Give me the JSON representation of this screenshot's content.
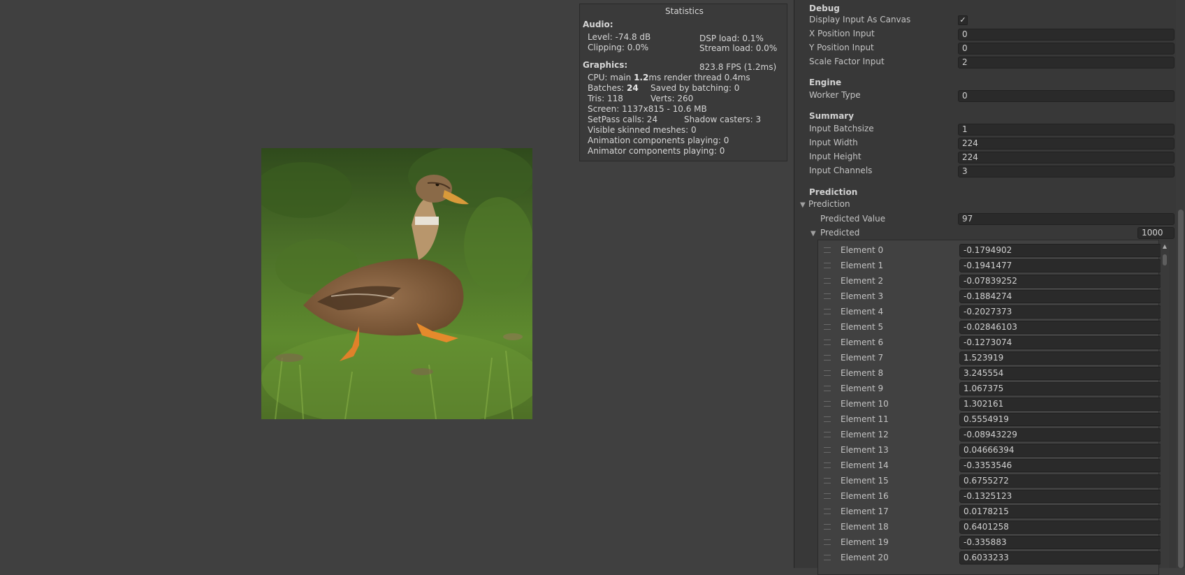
{
  "statistics": {
    "title": "Statistics",
    "audio_header": "Audio:",
    "level": "Level: -74.8 dB",
    "clipping": "Clipping: 0.0%",
    "dsp_load": "DSP load: 0.1%",
    "stream_load": "Stream load: 0.0%",
    "graphics_header": "Graphics:",
    "fps": "823.8 FPS (1.2ms)",
    "cpu_prefix": "CPU: main ",
    "cpu_main": "1.2",
    "cpu_suffix": "ms  render thread 0.4ms",
    "batches_prefix": "Batches: ",
    "batches_value": "24",
    "saved_by_batching": "Saved by batching: 0",
    "tris": "Tris: 118",
    "verts": "Verts: 260",
    "screen": "Screen: 1137x815 - 10.6 MB",
    "setpass_calls": "SetPass calls: 24",
    "shadow_casters": "Shadow casters: 3",
    "visible_skinned_meshes": "Visible skinned meshes: 0",
    "animation_components": "Animation components playing: 0",
    "animator_components": "Animator components playing: 0"
  },
  "inspector": {
    "debug": {
      "header": "Debug",
      "display_input_label": "Display Input As Canvas",
      "display_input_checked": true,
      "checkmark": "✓",
      "x_position_label": "X Position Input",
      "x_position_value": "0",
      "y_position_label": "Y Position Input",
      "y_position_value": "0",
      "scale_factor_label": "Scale Factor Input",
      "scale_factor_value": "2"
    },
    "engine": {
      "header": "Engine",
      "worker_type_label": "Worker Type",
      "worker_type_value": "0"
    },
    "summary": {
      "header": "Summary",
      "batchsize_label": "Input Batchsize",
      "batchsize_value": "1",
      "width_label": "Input Width",
      "width_value": "224",
      "height_label": "Input Height",
      "height_value": "224",
      "channels_label": "Input Channels",
      "channels_value": "3"
    },
    "prediction": {
      "header": "Prediction",
      "foldout_label": "Prediction",
      "predicted_value_label": "Predicted Value",
      "predicted_value": "97",
      "predicted_label": "Predicted",
      "predicted_size": "1000",
      "elements": [
        {
          "label": "Element 0",
          "value": "-0.1794902"
        },
        {
          "label": "Element 1",
          "value": "-0.1941477"
        },
        {
          "label": "Element 2",
          "value": "-0.07839252"
        },
        {
          "label": "Element 3",
          "value": "-0.1884274"
        },
        {
          "label": "Element 4",
          "value": "-0.2027373"
        },
        {
          "label": "Element 5",
          "value": "-0.02846103"
        },
        {
          "label": "Element 6",
          "value": "-0.1273074"
        },
        {
          "label": "Element 7",
          "value": "1.523919"
        },
        {
          "label": "Element 8",
          "value": "3.245554"
        },
        {
          "label": "Element 9",
          "value": "1.067375"
        },
        {
          "label": "Element 10",
          "value": "1.302161"
        },
        {
          "label": "Element 11",
          "value": "0.5554919"
        },
        {
          "label": "Element 12",
          "value": "-0.08943229"
        },
        {
          "label": "Element 13",
          "value": "0.04666394"
        },
        {
          "label": "Element 14",
          "value": "-0.3353546"
        },
        {
          "label": "Element 15",
          "value": "0.6755272"
        },
        {
          "label": "Element 16",
          "value": "-0.1325123"
        },
        {
          "label": "Element 17",
          "value": "0.0178215"
        },
        {
          "label": "Element 18",
          "value": "0.6401258"
        },
        {
          "label": "Element 19",
          "value": "-0.335883"
        },
        {
          "label": "Element 20",
          "value": "0.6033233"
        }
      ]
    }
  }
}
